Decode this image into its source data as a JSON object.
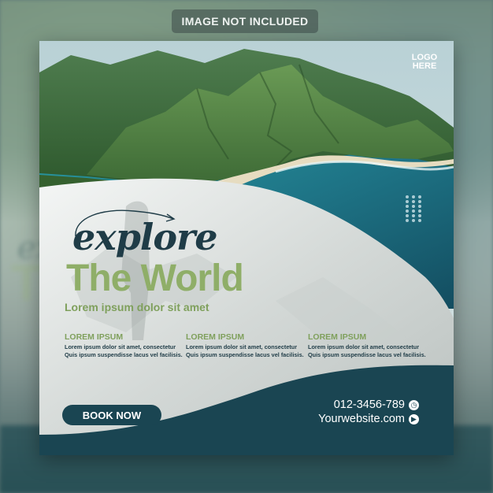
{
  "top_label": "IMAGE NOT INCLUDED",
  "logo": {
    "line1": "LOGO",
    "line2": "HERE"
  },
  "headline": {
    "script": "explore",
    "main": "The World",
    "sub": "Lorem ipsum dolor sit amet"
  },
  "columns": [
    {
      "title": "LOREM IPSUM",
      "text": "Lorem ipsum dolor sit amet, consectetur Quis ipsum suspendisse lacus vel facilisis."
    },
    {
      "title": "LOREM IPSUM",
      "text": "Lorem ipsum dolor sit amet, consectetur Quis ipsum suspendisse lacus vel facilisis."
    },
    {
      "title": "LOREM IPSUM",
      "text": "Lorem ipsum dolor sit amet, consectetur Quis ipsum suspendisse lacus vel facilisis."
    }
  ],
  "cta": {
    "label": "BOOK NOW"
  },
  "contact": {
    "phone": "012-3456-789",
    "website": "Yourwebsite.com",
    "phone_icon": "clock-icon",
    "website_icon": "play-icon"
  },
  "colors": {
    "dark_teal": "#1a4552",
    "olive_green": "#8fae68",
    "navy_text": "#1f3c47",
    "sea": "#2f8f99"
  }
}
